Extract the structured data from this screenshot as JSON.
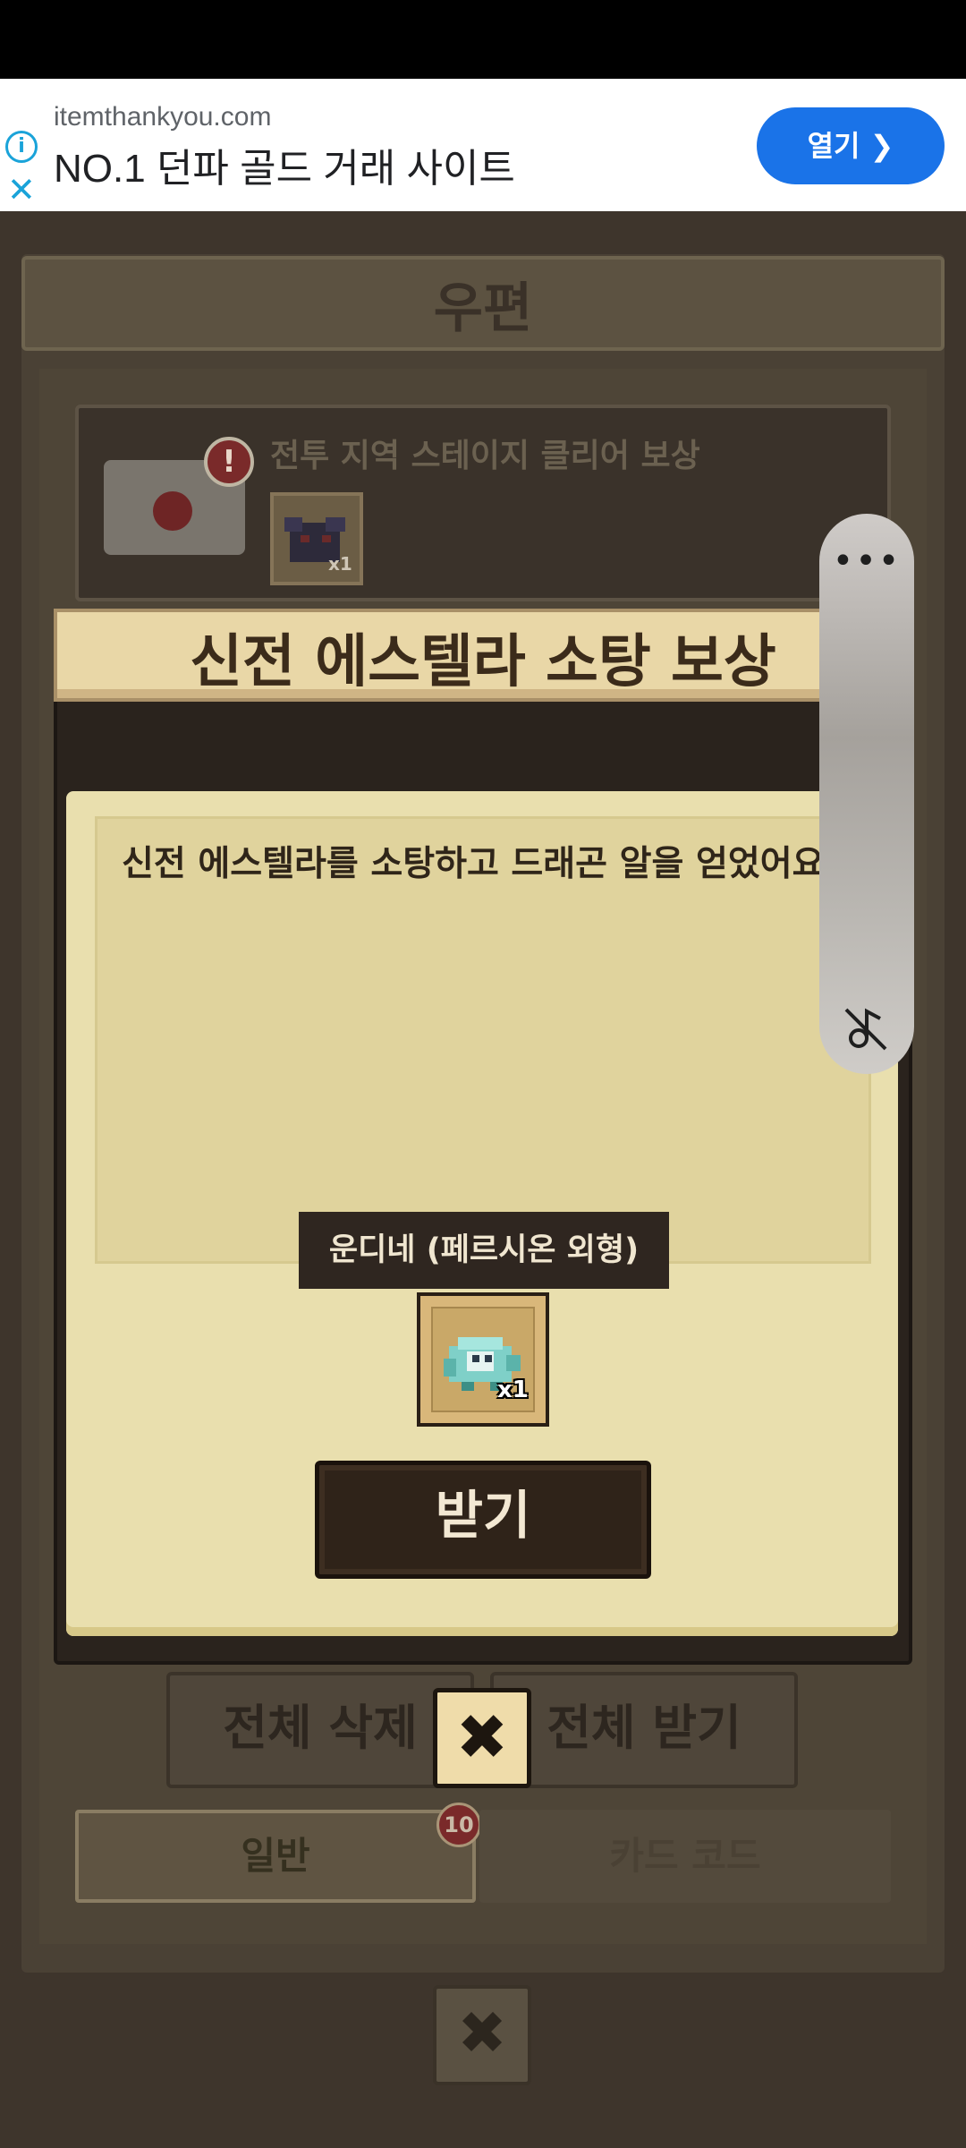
{
  "ad": {
    "domain": "itemthankyou.com",
    "headline": "NO.1 던파 골드 거래 사이트",
    "open_label": "열기 ❯",
    "info_icon": "info-icon",
    "close_icon": "close-icon"
  },
  "mail": {
    "title": "우편",
    "alert_glyph": "!",
    "item_subject": "전투 지역 스테이지 클리어 보상",
    "item_reward_count": "x1"
  },
  "modal": {
    "title": "신전 에스텔라 소탕 보상",
    "message": "신전 에스텔라를 소탕하고 드래곤 알을 얻었어요!",
    "reward_name": "운디네 (페르시온 외형)",
    "reward_count": "x1",
    "receive_label": "받기",
    "close_glyph": "✖"
  },
  "footer": {
    "delete_all_label": "전체 삭제",
    "get_all_label": "전체 받기",
    "tab_normal_label": "일반",
    "tab_normal_badge": "10",
    "tab_card_label": "카드 코드",
    "close_glyph": "✖"
  },
  "side_panel": {
    "more_glyph": "•••",
    "mute_icon": "mute-icon"
  },
  "colors": {
    "ad_button": "#1a73e8",
    "modal_title_bg": "#e9d7a7",
    "modal_body_bg": "#e9dfae",
    "receive_button_bg": "#2f2319",
    "badge_red": "#7a2a2a"
  }
}
